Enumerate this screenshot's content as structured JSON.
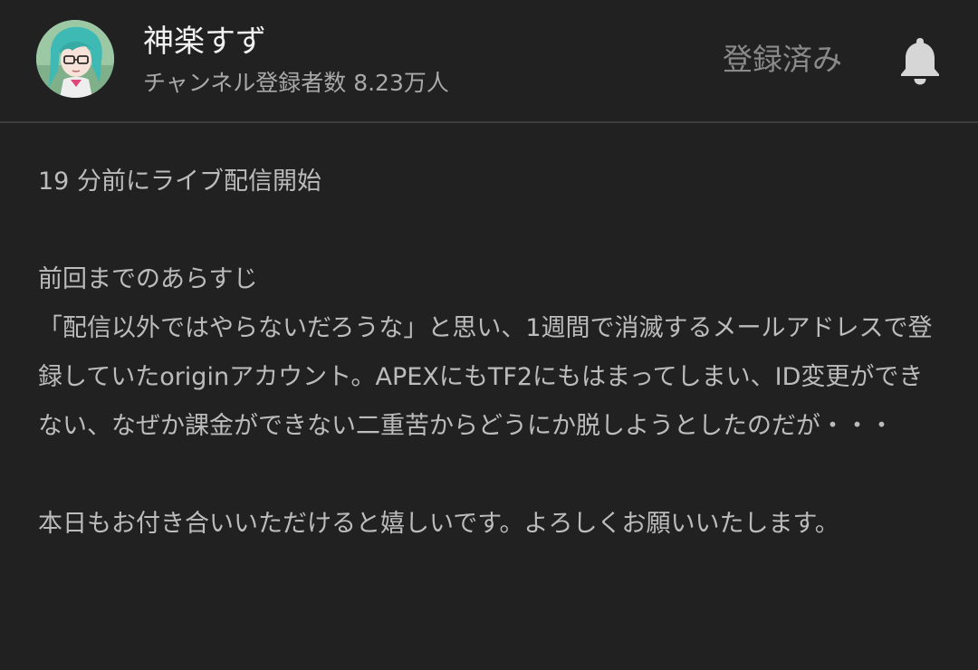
{
  "header": {
    "channel_name": "神楽すず",
    "subscriber_text": "チャンネル登録者数 8.23万人",
    "subscribe_button_label": "登録済み",
    "avatar_icon": "avatar-icon",
    "bell_icon": "bell-icon"
  },
  "description": {
    "stream_started": "19 分前にライブ配信開始",
    "paragraph1": [
      "前回までのあらすじ",
      "「配信以外ではやらないだろうな」と思い、1週間で消滅するメールアドレスで登録していたoriginアカウント。APEXにもTF2にもはまってしまい、ID変更ができない、なぜか課金ができない二重苦からどうにか脱しようとしたのだが・・・"
    ],
    "paragraph2": "本日もお付き合いいただけると嬉しいです。よろしくお願いいたします。"
  },
  "colors": {
    "background": "#212121",
    "primary_text": "#f1f1f1",
    "secondary_text": "#a9a9a9",
    "body_text": "#bcbcbc",
    "divider": "#3d3d3d"
  }
}
